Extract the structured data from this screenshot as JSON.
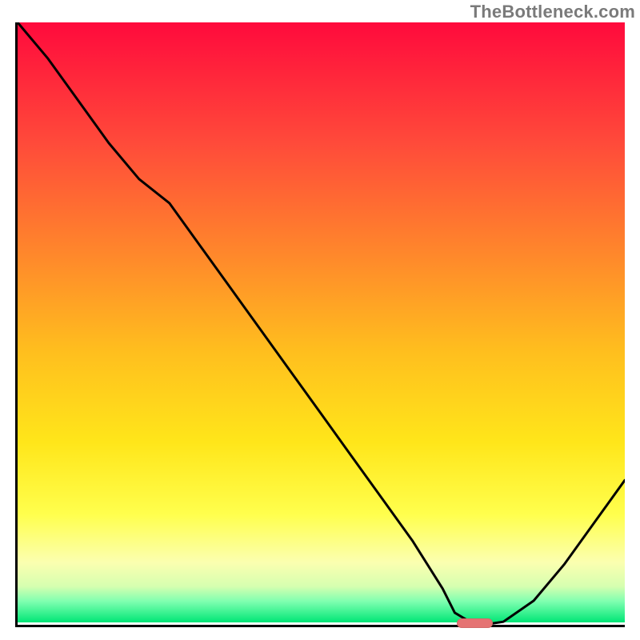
{
  "watermark": "TheBottleneck.com",
  "chart_data": {
    "type": "line",
    "title": "",
    "xlabel": "",
    "ylabel": "",
    "xlim": [
      0,
      100
    ],
    "ylim": [
      0,
      100
    ],
    "x": [
      0,
      5,
      10,
      15,
      20,
      25,
      30,
      35,
      40,
      45,
      50,
      55,
      60,
      65,
      70,
      72,
      75,
      78,
      80,
      85,
      90,
      95,
      100
    ],
    "values": [
      100,
      94,
      87,
      80,
      74,
      70,
      63,
      56,
      49,
      42,
      35,
      28,
      21,
      14,
      6,
      2,
      0.2,
      0.2,
      0.5,
      4,
      10,
      17,
      24
    ],
    "gradient_stops": [
      {
        "pos": 0.0,
        "color": "#ff0a3c"
      },
      {
        "pos": 0.2,
        "color": "#ff4a3a"
      },
      {
        "pos": 0.4,
        "color": "#ff8c2a"
      },
      {
        "pos": 0.55,
        "color": "#ffbf1e"
      },
      {
        "pos": 0.7,
        "color": "#ffe61a"
      },
      {
        "pos": 0.82,
        "color": "#ffff4d"
      },
      {
        "pos": 0.9,
        "color": "#fbffb0"
      },
      {
        "pos": 0.94,
        "color": "#d6ffb0"
      },
      {
        "pos": 0.965,
        "color": "#7fffb0"
      },
      {
        "pos": 1.0,
        "color": "#00e676"
      }
    ],
    "marker": {
      "x_start": 72,
      "x_end": 78,
      "y": 0.2,
      "color": "#e57373"
    }
  }
}
